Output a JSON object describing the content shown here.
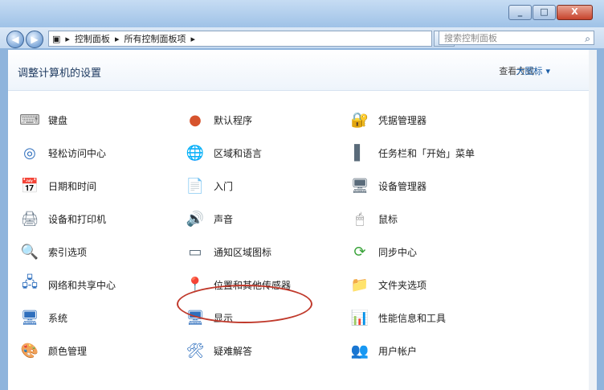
{
  "window": {
    "caption_buttons": {
      "minimize": "_",
      "maximize": "□",
      "close": "X"
    }
  },
  "nav": {
    "back": "◀",
    "forward": "▶",
    "breadcrumb": [
      "控制面板",
      "所有控制面板项"
    ],
    "search_placeholder": "搜索控制面板"
  },
  "header": {
    "title": "调整计算机的设置",
    "view_by_label": "查看方式:",
    "view_by_value": "大图标"
  },
  "items": [
    {
      "label": "键盘",
      "icon": "keyboard-icon",
      "glyph": "⌨",
      "color": "#7c7c7c"
    },
    {
      "label": "默认程序",
      "icon": "default-programs-icon",
      "glyph": "●",
      "color": "#d6532d"
    },
    {
      "label": "凭据管理器",
      "icon": "credential-manager-icon",
      "glyph": "🔐",
      "color": "#c58c2b"
    },
    {
      "label": "轻松访问中心",
      "icon": "ease-of-access-icon",
      "glyph": "◎",
      "color": "#2f6fbd"
    },
    {
      "label": "区域和语言",
      "icon": "region-language-icon",
      "glyph": "🌐",
      "color": "#3a89c9"
    },
    {
      "label": "任务栏和「开始」菜单",
      "icon": "taskbar-start-menu-icon",
      "glyph": "▌",
      "color": "#5a6b7a"
    },
    {
      "label": "日期和时间",
      "icon": "date-time-icon",
      "glyph": "📅",
      "color": "#4f8cc9"
    },
    {
      "label": "入门",
      "icon": "getting-started-icon",
      "glyph": "📄",
      "color": "#4f8cc9"
    },
    {
      "label": "设备管理器",
      "icon": "device-manager-icon",
      "glyph": "🖥",
      "color": "#5a6b7a"
    },
    {
      "label": "设备和打印机",
      "icon": "devices-printers-icon",
      "glyph": "🖨",
      "color": "#6f7f8f"
    },
    {
      "label": "声音",
      "icon": "sound-icon",
      "glyph": "🔊",
      "color": "#8a8a8a"
    },
    {
      "label": "鼠标",
      "icon": "mouse-icon",
      "glyph": "🖱",
      "color": "#8a8a8a"
    },
    {
      "label": "索引选项",
      "icon": "indexing-options-icon",
      "glyph": "🔍",
      "color": "#5a6b7a"
    },
    {
      "label": "通知区域图标",
      "icon": "notification-area-icon",
      "glyph": "▭",
      "color": "#5a6b7a"
    },
    {
      "label": "同步中心",
      "icon": "sync-center-icon",
      "glyph": "⟳",
      "color": "#3aa33a"
    },
    {
      "label": "网络和共享中心",
      "icon": "network-sharing-icon",
      "glyph": "🖧",
      "color": "#2f6fbd"
    },
    {
      "label": "位置和其他传感器",
      "icon": "location-sensors-icon",
      "glyph": "📍",
      "color": "#4f8cc9"
    },
    {
      "label": "文件夹选项",
      "icon": "folder-options-icon",
      "glyph": "📁",
      "color": "#d9b033"
    },
    {
      "label": "系统",
      "icon": "system-icon",
      "glyph": "🖥",
      "color": "#2f6fbd"
    },
    {
      "label": "显示",
      "icon": "display-icon",
      "glyph": "🖥",
      "color": "#2f6fbd"
    },
    {
      "label": "性能信息和工具",
      "icon": "performance-icon",
      "glyph": "📊",
      "color": "#3aa33a"
    },
    {
      "label": "颜色管理",
      "icon": "color-management-icon",
      "glyph": "🎨",
      "color": "#c93a3a"
    },
    {
      "label": "疑难解答",
      "icon": "troubleshooting-icon",
      "glyph": "🛠",
      "color": "#2f6fbd"
    },
    {
      "label": "用户帐户",
      "icon": "user-accounts-icon",
      "glyph": "👥",
      "color": "#4f8cc9"
    }
  ]
}
